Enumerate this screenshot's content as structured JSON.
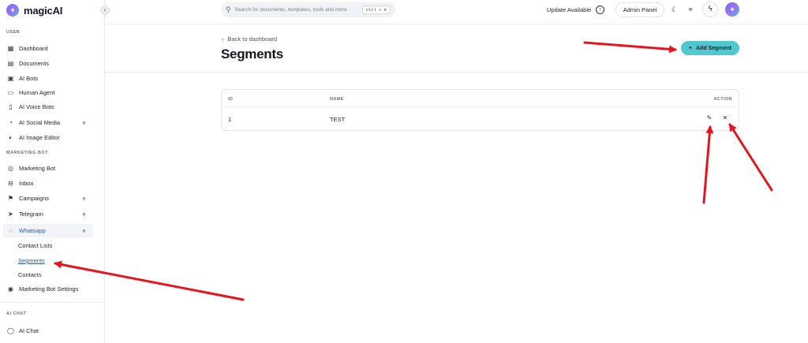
{
  "app": {
    "name": "magicAI"
  },
  "sidebar": {
    "section_user": "USER",
    "user_items": [
      {
        "label": "Dashboard",
        "icon": "dashboard-icon"
      },
      {
        "label": "Documents",
        "icon": "documents-icon"
      },
      {
        "label": "AI Bots",
        "icon": "bot-icon"
      },
      {
        "label": "Human Agent",
        "icon": "agent-icon"
      },
      {
        "label": "AI Voice Bots",
        "icon": "voice-icon"
      },
      {
        "label": "AI Social Media",
        "icon": "social-icon",
        "expandable": true
      },
      {
        "label": "AI Image Editor",
        "icon": "image-icon"
      }
    ],
    "section_marketing": "MARKETING BOT",
    "marketing_items": [
      {
        "label": "Marketing Bot",
        "icon": "marketing-icon"
      },
      {
        "label": "Inbox",
        "icon": "inbox-icon"
      },
      {
        "label": "Campaigns",
        "icon": "campaign-icon",
        "expandable": true
      },
      {
        "label": "Telegram",
        "icon": "telegram-icon",
        "expandable": true
      },
      {
        "label": "Whatsapp",
        "icon": "whatsapp-icon",
        "expandable": true,
        "active": true
      }
    ],
    "whatsapp_sub": [
      "Contact Lists",
      "Segments",
      "Contacts"
    ],
    "settings_item": "Marketing Bot Settings",
    "section_chat": "AI CHAT",
    "chat_item": "AI Chat"
  },
  "topbar": {
    "search_placeholder": "Search for documents, templates, tools and more",
    "shortcut": "ctrl + K",
    "update_label": "Update Available",
    "admin_label": "Admin Panel"
  },
  "page": {
    "back_label": "Back to dashboard",
    "title": "Segments",
    "add_button": "Add Segment"
  },
  "table": {
    "headers": {
      "id": "ID",
      "name": "NAME",
      "action": "ACTION"
    },
    "rows": [
      {
        "id": "1",
        "name": "TEST"
      }
    ]
  },
  "colors": {
    "accent": "#50c8cf",
    "arrow": "#e8141b",
    "link": "#2e5aa8"
  }
}
